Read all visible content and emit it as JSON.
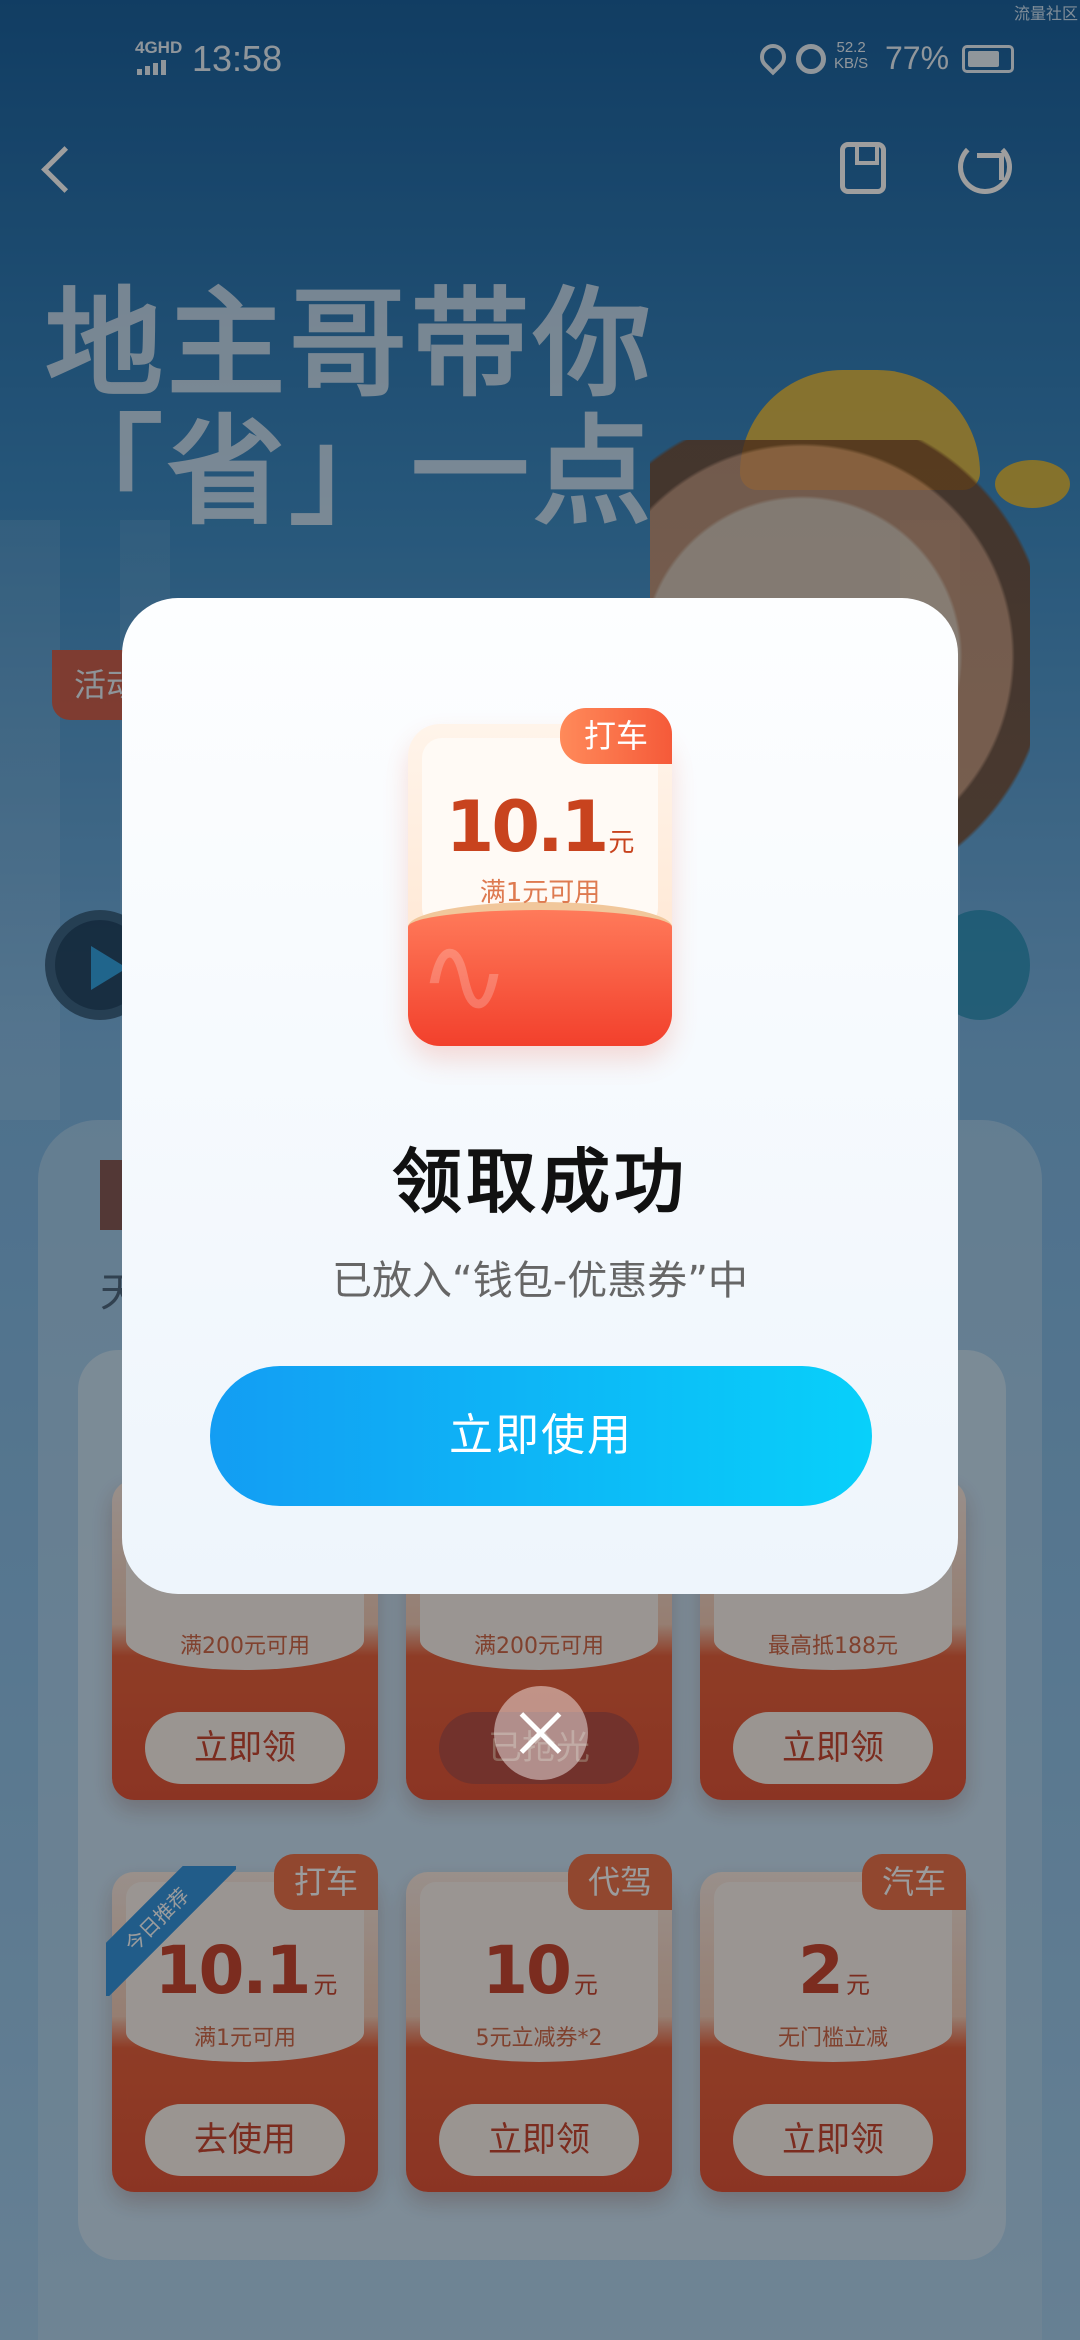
{
  "status_bar": {
    "network": "4GHD",
    "time": "13:58",
    "net_speed": "52.2\nKB/S",
    "battery": "77%",
    "corner_text": "流量社区"
  },
  "nav": {
    "back_icon": "chevron-left-icon",
    "save_icon": "bookmark-icon",
    "share_icon": "share-icon"
  },
  "hero": {
    "title_line1": "地主哥带你",
    "title_line2": "「省」一点",
    "tag": "活动"
  },
  "panel": {
    "sub_text": "天"
  },
  "coupons_row1": [
    {
      "cond": "满200元可用",
      "button": "立即领"
    },
    {
      "cond": "满200元可用",
      "button": "已抢光"
    },
    {
      "cond": "最高抵188元",
      "button": "立即领"
    }
  ],
  "coupons_row2": [
    {
      "category": "打车",
      "amount": "10.1",
      "unit": "元",
      "cond": "满1元可用",
      "button": "去使用",
      "ribbon": "今日推荐"
    },
    {
      "category": "代驾",
      "amount": "10",
      "unit": "元",
      "cond": "5元立减券*2",
      "button": "立即领"
    },
    {
      "category": "汽车",
      "amount": "2",
      "unit": "元",
      "cond": "无门槛立减",
      "button": "立即领"
    }
  ],
  "modal": {
    "coupon": {
      "category": "打车",
      "amount": "10.1",
      "unit": "元",
      "cond": "满1元可用"
    },
    "title": "领取成功",
    "subtitle": "已放入“钱包-优惠券”中",
    "button": "立即使用",
    "close_icon": "close-icon"
  },
  "colors": {
    "primary_button_start": "#139df3",
    "primary_button_end": "#08d0fa",
    "coupon_red": "#f2402c",
    "category_orange": "#f55a39"
  }
}
